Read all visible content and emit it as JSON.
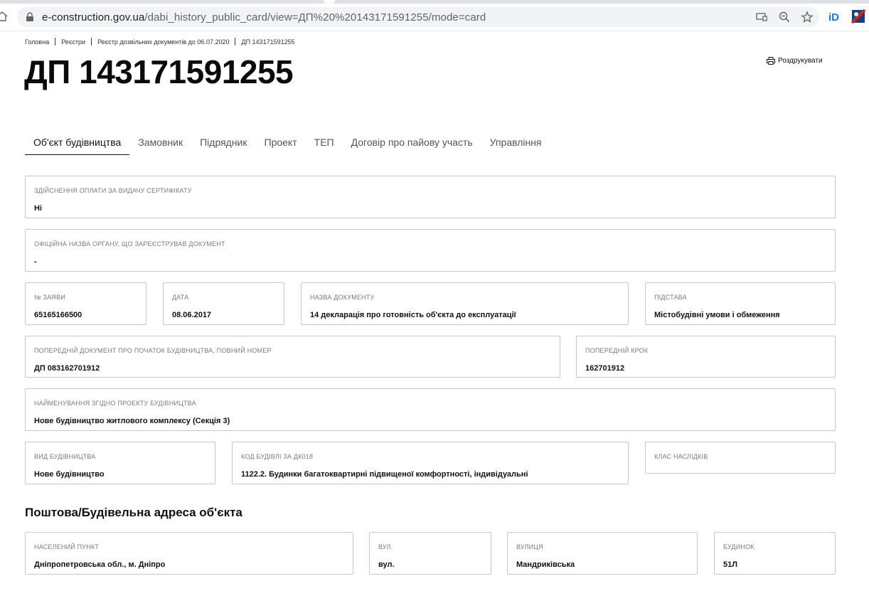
{
  "browser": {
    "url_host": "e-construction.gov.ua",
    "url_path": "/dabi_history_public_card/view=ДП%20%20143171591255/mode=card"
  },
  "breadcrumb": [
    "Головна",
    "Реєстри",
    "Реєстр дозвільних документів до 06.07.2020",
    "ДП 143171591255"
  ],
  "page_title": "ДП 143171591255",
  "print_label": "Роздрукувати",
  "tabs": [
    "Об'єкт будівництва",
    "Замовник",
    "Підрядник",
    "Проект",
    "ТЕП",
    "Договір про пайову участь",
    "Управління"
  ],
  "fields": {
    "payment": {
      "label": "Здійснення оплати за видачу сертифікату",
      "value": "Ні"
    },
    "authority": {
      "label": "Офіційна назва органу, що зареєстрував документ",
      "value": "-"
    },
    "app_number": {
      "label": "№ заяви",
      "value": "65165166500"
    },
    "date": {
      "label": "Дата",
      "value": "08.06.2017"
    },
    "doc_name": {
      "label": "Назва документу",
      "value": "14 декларація про готовність об'єкта до експлуатації"
    },
    "basis": {
      "label": "Підстава",
      "value": "Містобудівні умови і обмеження"
    },
    "prev_doc": {
      "label": "Попередній документ про початок будівництва, повний номер",
      "value": "ДП 083162701912"
    },
    "prev_step": {
      "label": "Попередній крок",
      "value": "162701912"
    },
    "project_name": {
      "label": "Найменування згідно проекту будівництва",
      "value": "Нове будівництво житлового комплексу (Секція 3)"
    },
    "build_type": {
      "label": "Вид будівництва",
      "value": "Нове будівництво"
    },
    "dk018": {
      "label": "Код будівлі за ДК018",
      "value": "1122.2. Будинки багатоквартирні підвищеної комфортності, індивідуальні"
    },
    "consequence_class": {
      "label": "Клас наслідків",
      "value": ""
    }
  },
  "address_section_title": "Поштова/Будівельна адреса об'єкта",
  "address": {
    "settlement": {
      "label": "Населений пункт",
      "value": "Дніпропетровська обл., м. Дніпро"
    },
    "street_type": {
      "label": "Вул.",
      "value": "вул."
    },
    "street": {
      "label": "Вулиця",
      "value": "Мандриківська"
    },
    "building": {
      "label": "Будинок",
      "value": "51Л"
    }
  }
}
